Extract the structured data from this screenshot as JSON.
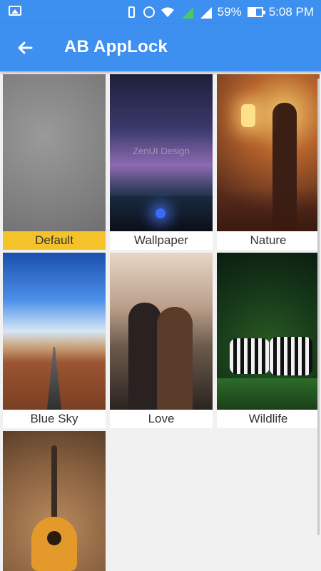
{
  "status_bar": {
    "battery_percent": "59%",
    "time": "5:08 PM"
  },
  "app_bar": {
    "title": "AB AppLock",
    "back_icon": "arrow-left-icon"
  },
  "wallpapers": [
    {
      "label": "Default",
      "selected": true
    },
    {
      "label": "Wallpaper",
      "watermark": "ZenUI Design"
    },
    {
      "label": "Nature"
    },
    {
      "label": "Blue Sky"
    },
    {
      "label": "Love"
    },
    {
      "label": "Wildlife"
    },
    {
      "label": ""
    }
  ],
  "colors": {
    "primary": "#3d8ff0",
    "selected_label_bg": "#f4c32a",
    "background": "#f1f1f1"
  }
}
